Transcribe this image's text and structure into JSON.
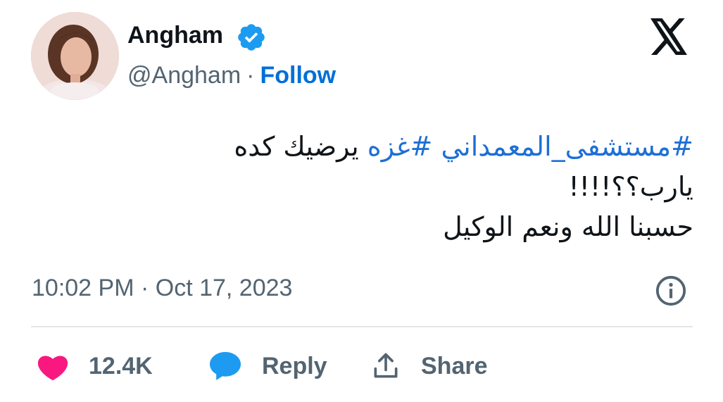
{
  "tweet": {
    "author": {
      "display_name": "Angham",
      "handle": "@Angham",
      "separator": "·",
      "follow_label": "Follow",
      "verified": true
    },
    "text": {
      "line1": {
        "hashtag1": "#مستشفى_المعمداني",
        "hashtag2": "#غزه",
        "rest": "يرضيك كده"
      },
      "line2": "يارب؟؟!!!!",
      "line3": "حسبنا الله ونعم الوكيل"
    },
    "timestamp": "10:02 PM · Oct 17, 2023",
    "actions": {
      "likes": "12.4K",
      "reply_label": "Reply",
      "share_label": "Share"
    }
  },
  "colors": {
    "link": "#006fd6",
    "hashtag": "#1d6fd6",
    "verified_badge": "#1d9bf0",
    "like_heart": "#f91880",
    "reply_bubble": "#1d9bf0",
    "secondary_text": "#536471"
  },
  "icons": [
    "verified-badge-icon",
    "x-logo-icon",
    "info-icon",
    "heart-icon",
    "reply-bubble-icon",
    "share-icon"
  ]
}
